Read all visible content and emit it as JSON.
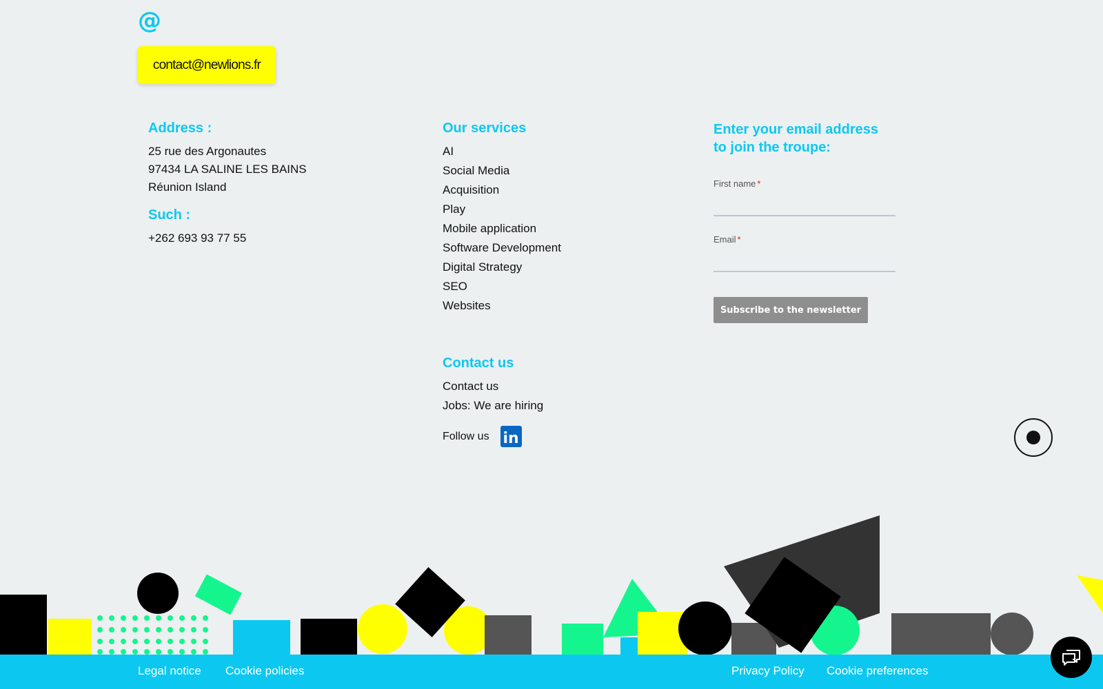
{
  "contact_email": {
    "icon": "at-icon",
    "label": "contact@newlions.fr"
  },
  "address": {
    "heading": "Address :",
    "lines": [
      "25 rue des Argonautes",
      "97434 LA SALINE LES BAINS",
      "Réunion Island"
    ],
    "phone_heading": "Such :",
    "phone": "+262 693 93 77 55"
  },
  "services": {
    "heading": "Our services",
    "items": [
      "AI",
      "Social Media",
      "Acquisition",
      "Play",
      "Mobile application",
      "Software Development",
      "Digital Strategy",
      "SEO",
      "Websites"
    ]
  },
  "contact": {
    "heading": "Contact us",
    "items": [
      "Contact us",
      "Jobs: We are hiring"
    ],
    "follow_label": "Follow us",
    "linkedin_icon": "linkedin-icon",
    "linkedin_glyph": "in"
  },
  "newsletter": {
    "heading_line1": "Enter your email address",
    "heading_line2": "to join the troupe:",
    "first_name_label": "First name",
    "email_label": "Email",
    "required_mark": "*",
    "first_name_value": "",
    "email_value": "",
    "subscribe_label": "Subscribe to the newsletter"
  },
  "footer": {
    "legal": "Legal notice",
    "cookie_policies": "Cookie policies",
    "privacy": "Privacy Policy",
    "cookie_prefs": "Cookie preferences"
  },
  "colors": {
    "accent_cyan": "#0cc8f1",
    "yellow": "#ffff00",
    "green": "#14f58e",
    "dark_gray": "#555555",
    "black": "#000000"
  }
}
